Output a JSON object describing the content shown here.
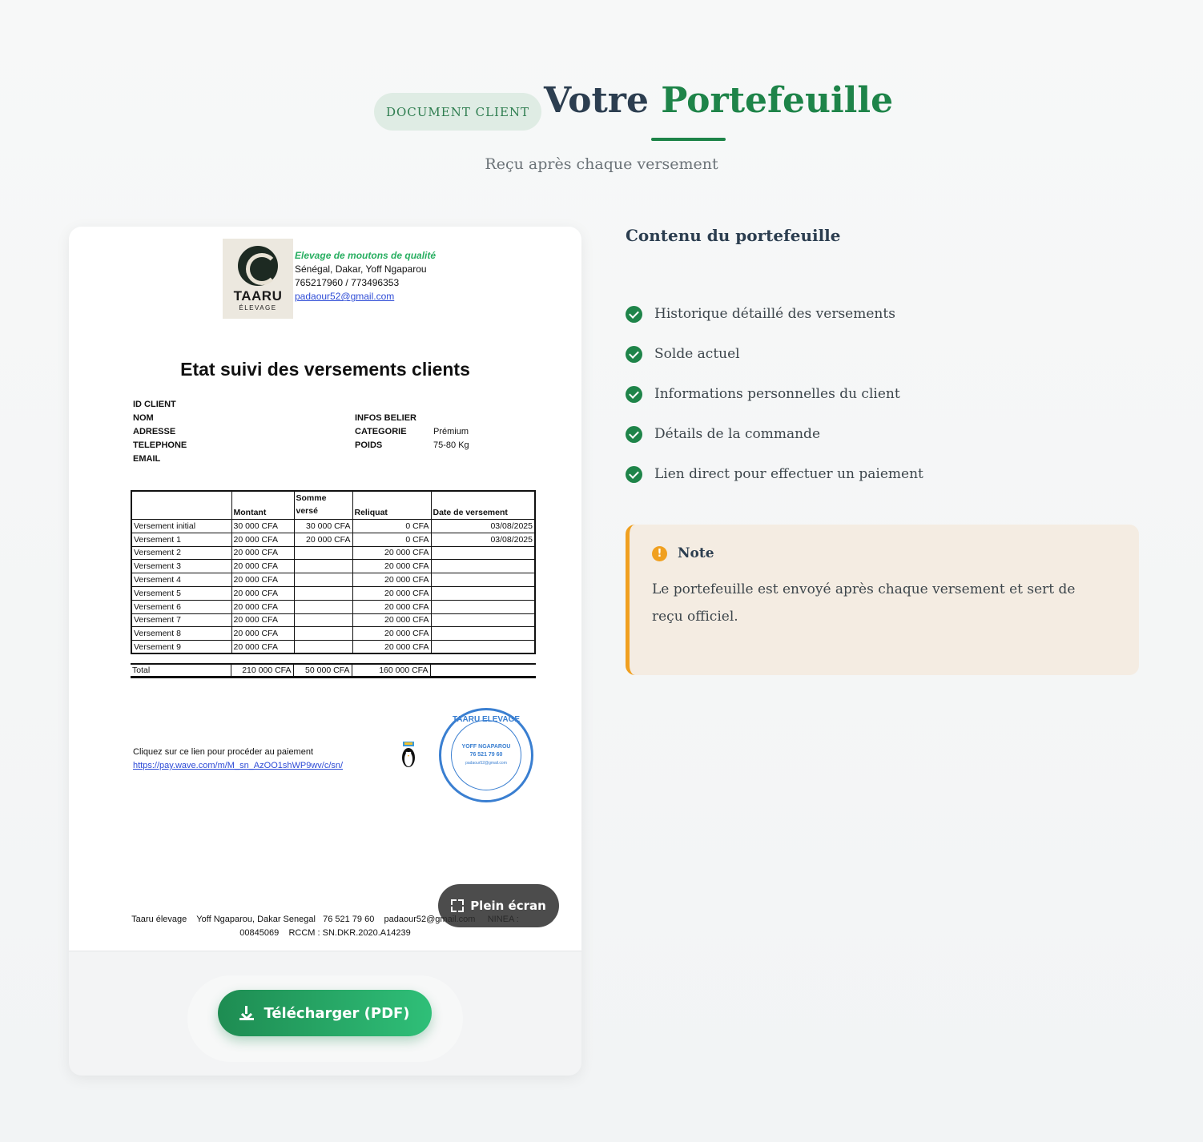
{
  "header": {
    "badge": "DOCUMENT CLIENT",
    "title_part1": "Votre",
    "title_part2": "Portefeuille",
    "subtitle": "Reçu après chaque versement"
  },
  "document": {
    "logo_name": "TAARU",
    "logo_sub": "ÉLEVAGE",
    "company_tagline": "Elevage de moutons de qualité",
    "company_address": "Sénégal, Dakar, Yoff Ngaparou",
    "company_phone": "765217960 / 773496353",
    "company_email": "padaour52@gmail.com",
    "title": "Etat suivi des versements clients",
    "fields_left": [
      "ID CLIENT",
      "NOM",
      "ADRESSE",
      "TELEPHONE",
      "EMAIL"
    ],
    "info_belier_label": "INFOS BELIER",
    "categorie_label": "CATEGORIE",
    "categorie_value": "Prémium",
    "poids_label": "POIDS",
    "poids_value": "75-80 Kg",
    "table_headers": [
      "",
      "Montant",
      "Somme versé",
      "Reliquat",
      "Date de versement"
    ],
    "table_rows": [
      [
        "Versement initial",
        "30 000 CFA",
        "30 000 CFA",
        "0 CFA",
        "03/08/2025"
      ],
      [
        "Versement 1",
        "20 000 CFA",
        "20 000 CFA",
        "0 CFA",
        "03/08/2025"
      ],
      [
        "Versement 2",
        "20 000 CFA",
        "",
        "20 000 CFA",
        ""
      ],
      [
        "Versement 3",
        "20 000 CFA",
        "",
        "20 000 CFA",
        ""
      ],
      [
        "Versement 4",
        "20 000 CFA",
        "",
        "20 000 CFA",
        ""
      ],
      [
        "Versement 5",
        "20 000 CFA",
        "",
        "20 000 CFA",
        ""
      ],
      [
        "Versement 6",
        "20 000 CFA",
        "",
        "20 000 CFA",
        ""
      ],
      [
        "Versement 7",
        "20 000 CFA",
        "",
        "20 000 CFA",
        ""
      ],
      [
        "Versement 8",
        "20 000 CFA",
        "",
        "20 000 CFA",
        ""
      ],
      [
        "Versement 9",
        "20 000 CFA",
        "",
        "20 000 CFA",
        ""
      ]
    ],
    "total_row": [
      "Total",
      "210 000 CFA",
      "50 000 CFA",
      "160 000 CFA",
      ""
    ],
    "payment_prompt": "Cliquez sur ce lien pour procéder au paiement",
    "payment_url": "https://pay.wave.com/m/M_sn_AzOO1shWP9wv/c/sn/",
    "stamp_top": "TAARU ELEVAGE",
    "stamp_line1": "YOFF NGAPAROU",
    "stamp_line2": "76 521 79 60",
    "stamp_line3": "padaour52@gmail.com",
    "footer_line1": "Taaru élevage    Yoff Ngaparou, Dakar Senegal   76 521 79 60    padaour52@gmail.com     NINEA :",
    "footer_line2": "00845069    RCCM : SN.DKR.2020.A14239"
  },
  "buttons": {
    "fullscreen": "Plein écran",
    "download": "Télécharger (PDF)"
  },
  "contents": {
    "title": "Contenu du portefeuille",
    "items": [
      "Historique détaillé des versements",
      "Solde actuel",
      "Informations personnelles du client",
      "Détails de la commande",
      "Lien direct pour effectuer un paiement"
    ]
  },
  "note": {
    "title": "Note",
    "text": "Le portefeuille est envoyé après chaque versement et sert de reçu officiel."
  },
  "colors": {
    "accent": "#1e8449",
    "note_border": "#f0a020",
    "note_bg": "#f4ece2"
  }
}
